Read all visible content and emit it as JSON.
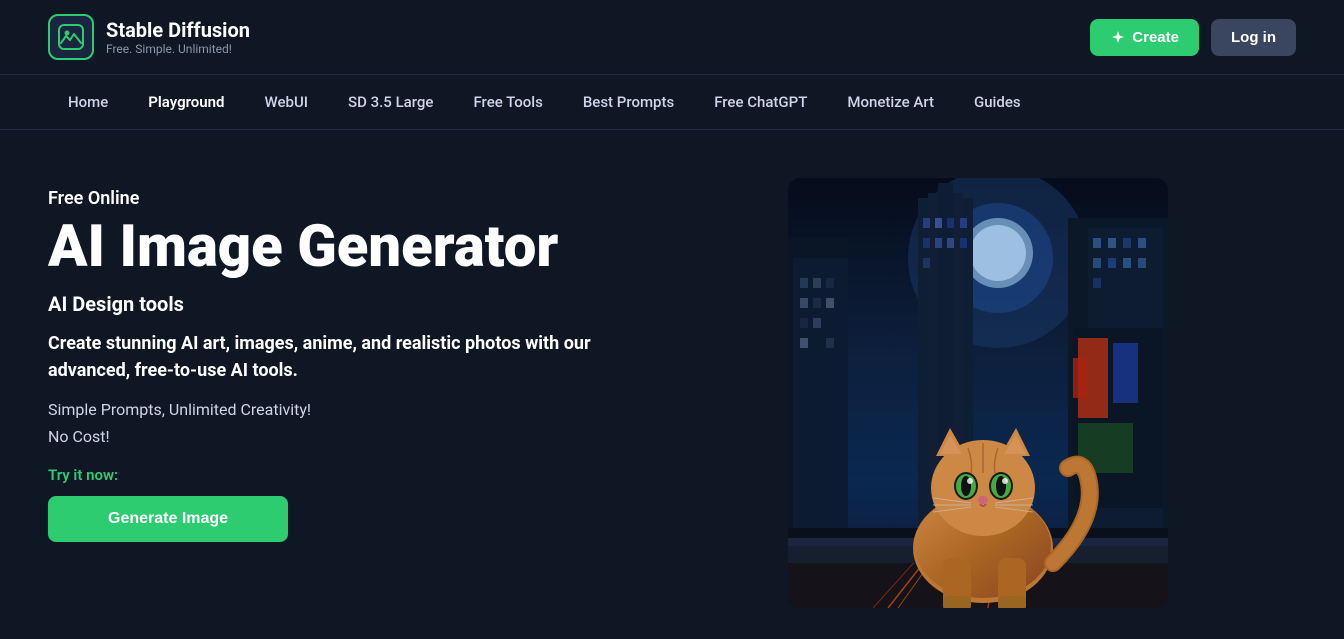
{
  "header": {
    "brand_name": "Stable Diffusion",
    "brand_tagline": "Free. Simple. Unlimited!",
    "create_button": "Create",
    "login_button": "Log in"
  },
  "nav": {
    "items": [
      {
        "label": "Home",
        "active": false
      },
      {
        "label": "Playground",
        "active": true
      },
      {
        "label": "WebUI",
        "active": false
      },
      {
        "label": "SD 3.5 Large",
        "active": false
      },
      {
        "label": "Free Tools",
        "active": false
      },
      {
        "label": "Best Prompts",
        "active": false
      },
      {
        "label": "Free ChatGPT",
        "active": false
      },
      {
        "label": "Monetize Art",
        "active": false
      },
      {
        "label": "Guides",
        "active": false
      }
    ]
  },
  "hero": {
    "free_online_label": "Free Online",
    "title": "AI Image Generator",
    "subtitle": "AI Design tools",
    "description": "Create stunning AI art, images, anime, and realistic photos with our advanced, free-to-use AI tools.",
    "tagline": "Simple Prompts, Unlimited Creativity!",
    "no_cost": "No Cost!",
    "try_now_label": "Try it now:",
    "cta_button": "Generate Image"
  }
}
